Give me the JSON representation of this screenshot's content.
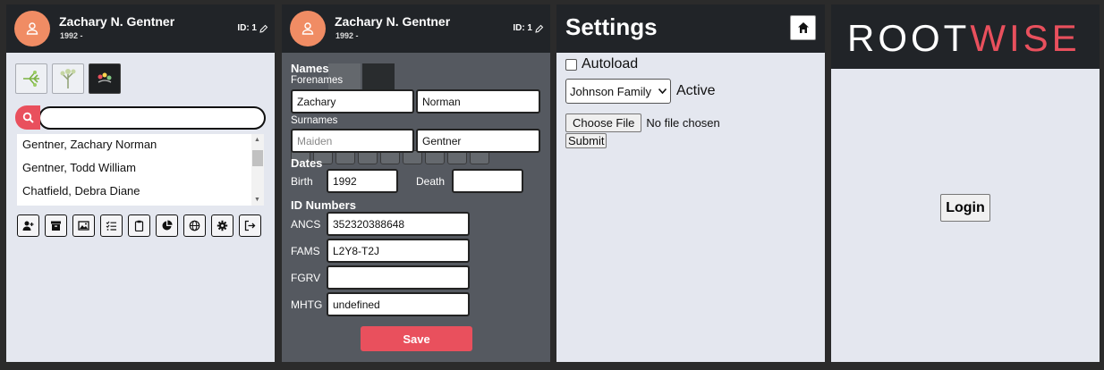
{
  "profile": {
    "name": "Zachary N. Gentner",
    "years": "1992 -",
    "id_label": "ID: 1"
  },
  "people_list": [
    "Gentner, Zachary Norman",
    "Gentner, Todd William",
    "Chatfield, Debra Diane"
  ],
  "editor": {
    "names_heading": "Names",
    "forenames_label": "Forenames",
    "forename1": "Zachary",
    "forename2": "Norman",
    "surnames_label": "Surnames",
    "maiden_placeholder": "Maiden",
    "surname": "Gentner",
    "dates_heading": "Dates",
    "birth_label": "Birth",
    "birth_value": "1992",
    "death_label": "Death",
    "death_value": "",
    "ids_heading": "ID Numbers",
    "ancs_label": "ANCS",
    "ancs_value": "352320388648",
    "fams_label": "FAMS",
    "fams_value": "L2Y8-T2J",
    "fgrv_label": "FGRV",
    "fgrv_value": "",
    "mhtg_label": "MHTG",
    "mhtg_value": "undefined",
    "save_label": "Save"
  },
  "settings": {
    "title": "Settings",
    "autoload_label": "Autoload",
    "family_selected": "Johnson Family",
    "active_label": "Active",
    "choose_file_label": "Choose File",
    "no_file_label": "No file chosen",
    "submit_label": "Submit"
  },
  "login": {
    "brand_part1": "ROOT",
    "brand_part2": "WISE",
    "login_label": "Login"
  },
  "colors": {
    "accent": "#e9505d",
    "avatar": "#f08c64",
    "header": "#212428"
  }
}
